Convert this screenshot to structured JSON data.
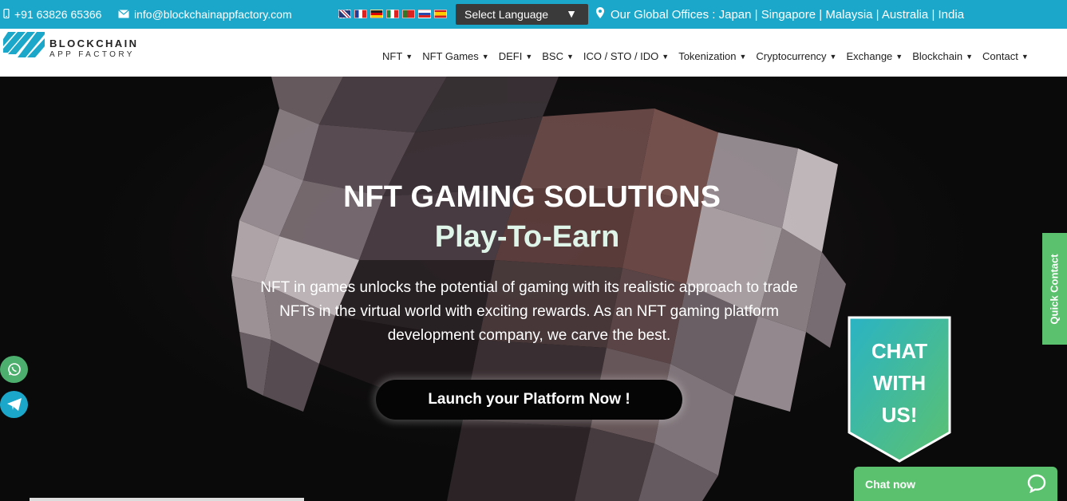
{
  "topbar": {
    "phone": "+91 63826 65366",
    "email": "info@blockchainappfactory.com",
    "language_select": "Select Language",
    "offices": "Our Global Offices : Japan | Singapore | Malaysia | Australia | India"
  },
  "logo": {
    "line1": "BLOCKCHAIN",
    "line2": "APP FACTORY"
  },
  "nav": [
    {
      "label": "NFT"
    },
    {
      "label": "NFT Games"
    },
    {
      "label": "DEFI"
    },
    {
      "label": "BSC"
    },
    {
      "label": "ICO / STO / IDO"
    },
    {
      "label": "Tokenization"
    },
    {
      "label": "Cryptocurrency"
    },
    {
      "label": "Exchange"
    },
    {
      "label": "Blockchain"
    },
    {
      "label": "Contact"
    }
  ],
  "hero": {
    "title": "NFT GAMING SOLUTIONS",
    "subtitle": "Play-To-Earn",
    "description": "NFT in games unlocks the potential of gaming with its realistic approach to trade NFTs in the virtual world with exciting rewards. As an NFT gaming platform development company, we carve the best.",
    "cta": "Launch your Platform Now !"
  },
  "widgets": {
    "quick_contact": "Quick Contact",
    "chat_badge": [
      "CHAT",
      "WITH",
      "US!"
    ],
    "chat_now": "Chat now"
  },
  "icons": {
    "phone": "phone-icon",
    "email": "envelope-icon",
    "location": "map-pin-icon",
    "whatsapp": "whatsapp-icon",
    "telegram": "telegram-icon",
    "chat": "chat-bubble-icon"
  },
  "colors": {
    "topbar": "#1aa7c9",
    "accent_green": "#5cc16f",
    "hero_bg": "#0a0a0a"
  }
}
